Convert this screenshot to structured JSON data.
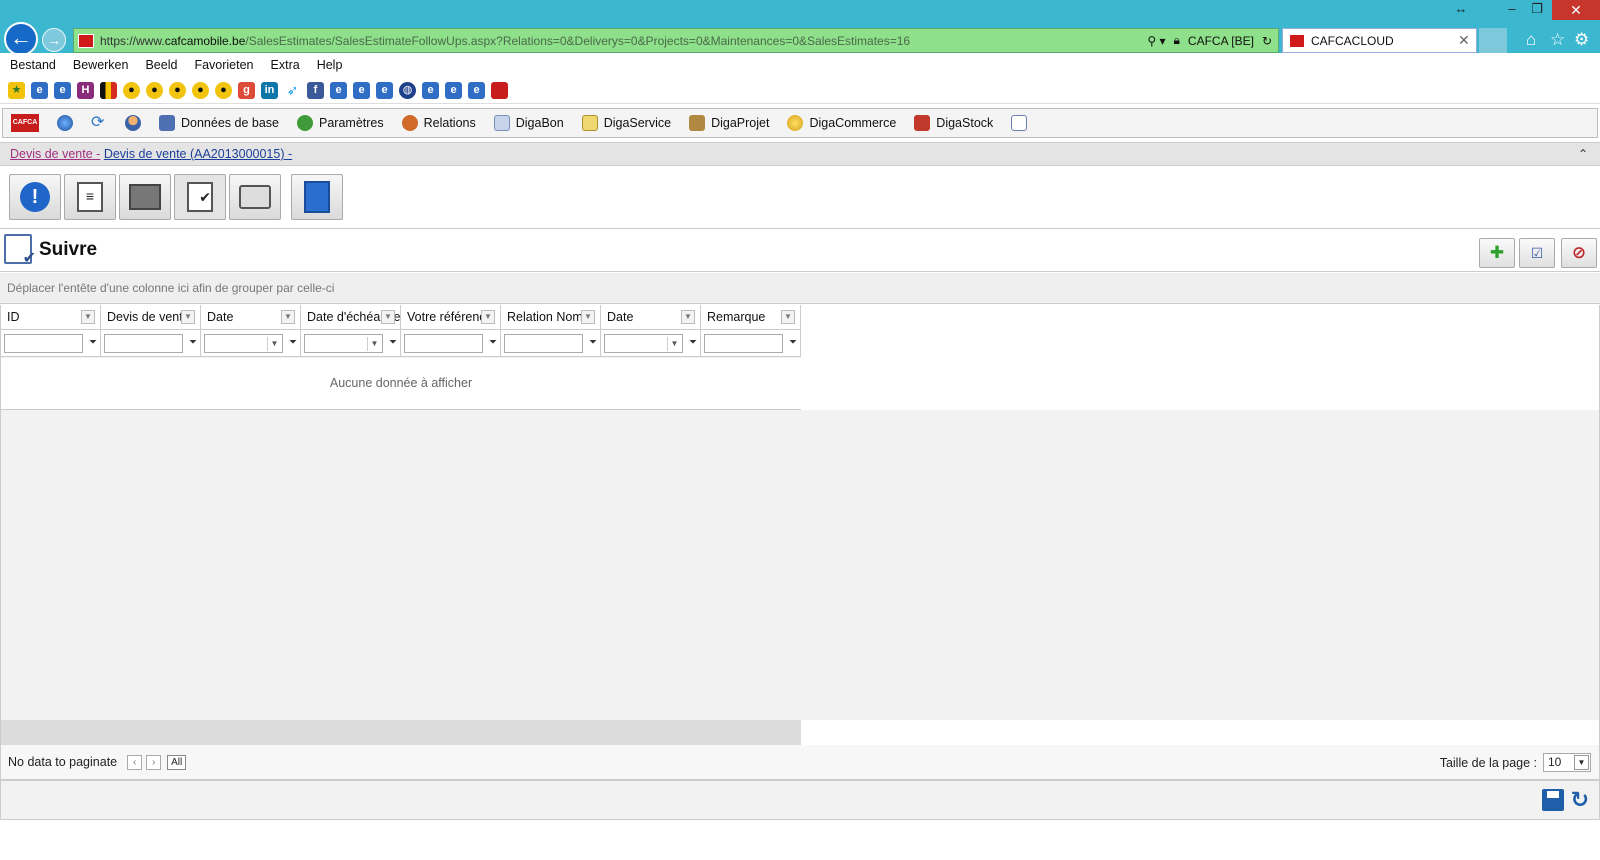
{
  "browser": {
    "url_prefix": "https://www.",
    "url_host": "cafcamobile.be",
    "url_path": "/SalesEstimates/SalesEstimateFollowUps.aspx?Relations=0&Deliverys=0&Projects=0&Maintenances=0&SalesEstimates=16",
    "cert_label": "CAFCA [BE]",
    "tab_title": "CAFCACLOUD"
  },
  "menubar": [
    "Bestand",
    "Bewerken",
    "Beeld",
    "Favorieten",
    "Extra",
    "Help"
  ],
  "appnav": {
    "logo_text": "CAFCA",
    "items": [
      "Données de base",
      "Paramètres",
      "Relations",
      "DigaBon",
      "DigaService",
      "DigaProjet",
      "DigaCommerce",
      "DigaStock"
    ]
  },
  "breadcrumb": {
    "part1": "Devis de vente -",
    "part2": "Devis de vente (AA2013000015) -",
    "collapse_icon": "⌃"
  },
  "section": {
    "title": "Suivre"
  },
  "grid": {
    "group_hint": "Déplacer l'entête d'une colonne ici afin de grouper par celle-ci",
    "columns": [
      "ID",
      "Devis de vente",
      "Date",
      "Date d'échéance",
      "Votre référence",
      "Relation Nom",
      "Date",
      "Remarque"
    ],
    "empty_text": "Aucune donnée à afficher"
  },
  "pager": {
    "status": "No data to paginate",
    "all_label": "All",
    "page_size_label": "Taille de la page :",
    "page_size_value": "10"
  },
  "colors": {
    "titlebar": "#3bb7d0",
    "addressbar": "#8ee08a",
    "link_primary": "#a0307f",
    "link_secondary": "#1b3f9a"
  }
}
